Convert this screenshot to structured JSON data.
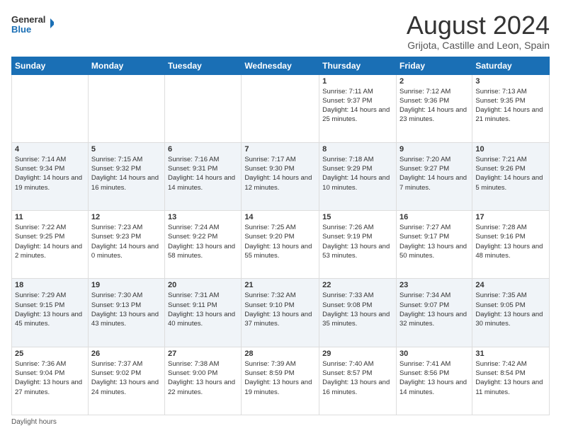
{
  "header": {
    "logo_line1": "General",
    "logo_line2": "Blue",
    "month": "August 2024",
    "location": "Grijota, Castille and Leon, Spain"
  },
  "days_of_week": [
    "Sunday",
    "Monday",
    "Tuesday",
    "Wednesday",
    "Thursday",
    "Friday",
    "Saturday"
  ],
  "weeks": [
    [
      {
        "num": "",
        "info": ""
      },
      {
        "num": "",
        "info": ""
      },
      {
        "num": "",
        "info": ""
      },
      {
        "num": "",
        "info": ""
      },
      {
        "num": "1",
        "info": "Sunrise: 7:11 AM\nSunset: 9:37 PM\nDaylight: 14 hours and 25 minutes."
      },
      {
        "num": "2",
        "info": "Sunrise: 7:12 AM\nSunset: 9:36 PM\nDaylight: 14 hours and 23 minutes."
      },
      {
        "num": "3",
        "info": "Sunrise: 7:13 AM\nSunset: 9:35 PM\nDaylight: 14 hours and 21 minutes."
      }
    ],
    [
      {
        "num": "4",
        "info": "Sunrise: 7:14 AM\nSunset: 9:34 PM\nDaylight: 14 hours and 19 minutes."
      },
      {
        "num": "5",
        "info": "Sunrise: 7:15 AM\nSunset: 9:32 PM\nDaylight: 14 hours and 16 minutes."
      },
      {
        "num": "6",
        "info": "Sunrise: 7:16 AM\nSunset: 9:31 PM\nDaylight: 14 hours and 14 minutes."
      },
      {
        "num": "7",
        "info": "Sunrise: 7:17 AM\nSunset: 9:30 PM\nDaylight: 14 hours and 12 minutes."
      },
      {
        "num": "8",
        "info": "Sunrise: 7:18 AM\nSunset: 9:29 PM\nDaylight: 14 hours and 10 minutes."
      },
      {
        "num": "9",
        "info": "Sunrise: 7:20 AM\nSunset: 9:27 PM\nDaylight: 14 hours and 7 minutes."
      },
      {
        "num": "10",
        "info": "Sunrise: 7:21 AM\nSunset: 9:26 PM\nDaylight: 14 hours and 5 minutes."
      }
    ],
    [
      {
        "num": "11",
        "info": "Sunrise: 7:22 AM\nSunset: 9:25 PM\nDaylight: 14 hours and 2 minutes."
      },
      {
        "num": "12",
        "info": "Sunrise: 7:23 AM\nSunset: 9:23 PM\nDaylight: 14 hours and 0 minutes."
      },
      {
        "num": "13",
        "info": "Sunrise: 7:24 AM\nSunset: 9:22 PM\nDaylight: 13 hours and 58 minutes."
      },
      {
        "num": "14",
        "info": "Sunrise: 7:25 AM\nSunset: 9:20 PM\nDaylight: 13 hours and 55 minutes."
      },
      {
        "num": "15",
        "info": "Sunrise: 7:26 AM\nSunset: 9:19 PM\nDaylight: 13 hours and 53 minutes."
      },
      {
        "num": "16",
        "info": "Sunrise: 7:27 AM\nSunset: 9:17 PM\nDaylight: 13 hours and 50 minutes."
      },
      {
        "num": "17",
        "info": "Sunrise: 7:28 AM\nSunset: 9:16 PM\nDaylight: 13 hours and 48 minutes."
      }
    ],
    [
      {
        "num": "18",
        "info": "Sunrise: 7:29 AM\nSunset: 9:15 PM\nDaylight: 13 hours and 45 minutes."
      },
      {
        "num": "19",
        "info": "Sunrise: 7:30 AM\nSunset: 9:13 PM\nDaylight: 13 hours and 43 minutes."
      },
      {
        "num": "20",
        "info": "Sunrise: 7:31 AM\nSunset: 9:11 PM\nDaylight: 13 hours and 40 minutes."
      },
      {
        "num": "21",
        "info": "Sunrise: 7:32 AM\nSunset: 9:10 PM\nDaylight: 13 hours and 37 minutes."
      },
      {
        "num": "22",
        "info": "Sunrise: 7:33 AM\nSunset: 9:08 PM\nDaylight: 13 hours and 35 minutes."
      },
      {
        "num": "23",
        "info": "Sunrise: 7:34 AM\nSunset: 9:07 PM\nDaylight: 13 hours and 32 minutes."
      },
      {
        "num": "24",
        "info": "Sunrise: 7:35 AM\nSunset: 9:05 PM\nDaylight: 13 hours and 30 minutes."
      }
    ],
    [
      {
        "num": "25",
        "info": "Sunrise: 7:36 AM\nSunset: 9:04 PM\nDaylight: 13 hours and 27 minutes."
      },
      {
        "num": "26",
        "info": "Sunrise: 7:37 AM\nSunset: 9:02 PM\nDaylight: 13 hours and 24 minutes."
      },
      {
        "num": "27",
        "info": "Sunrise: 7:38 AM\nSunset: 9:00 PM\nDaylight: 13 hours and 22 minutes."
      },
      {
        "num": "28",
        "info": "Sunrise: 7:39 AM\nSunset: 8:59 PM\nDaylight: 13 hours and 19 minutes."
      },
      {
        "num": "29",
        "info": "Sunrise: 7:40 AM\nSunset: 8:57 PM\nDaylight: 13 hours and 16 minutes."
      },
      {
        "num": "30",
        "info": "Sunrise: 7:41 AM\nSunset: 8:56 PM\nDaylight: 13 hours and 14 minutes."
      },
      {
        "num": "31",
        "info": "Sunrise: 7:42 AM\nSunset: 8:54 PM\nDaylight: 13 hours and 11 minutes."
      }
    ]
  ],
  "footer": {
    "note": "Daylight hours"
  },
  "colors": {
    "header_bg": "#1a6fb5",
    "accent": "#1a6fb5"
  }
}
